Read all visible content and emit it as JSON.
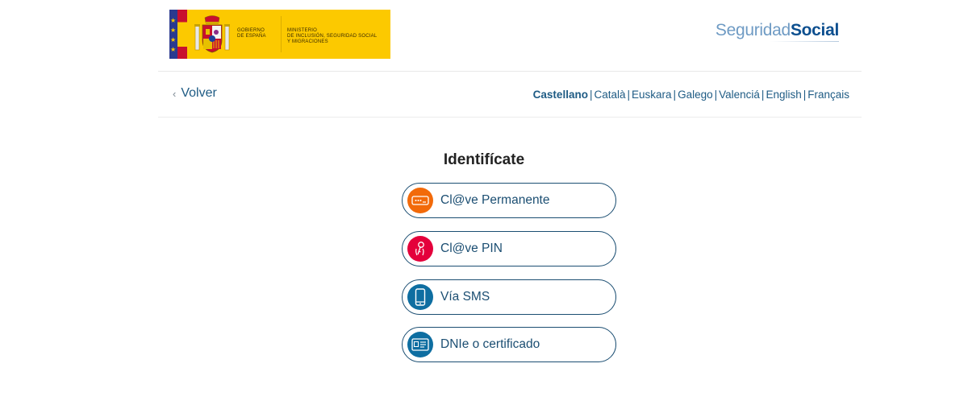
{
  "header": {
    "gov_line1": "GOBIERNO",
    "gov_line2": "DE ESPAÑA",
    "ministry_line1": "MINISTERIO",
    "ministry_line2": "DE INCLUSIÓN, SEGURIDAD SOCIAL",
    "ministry_line3": "Y MIGRACIONES",
    "ss_logo_light": "Seguridad",
    "ss_logo_bold": "Social"
  },
  "nav": {
    "back_label": "Volver",
    "back_chevron": "‹",
    "languages": [
      {
        "label": "Castellano",
        "active": true
      },
      {
        "label": "Català",
        "active": false
      },
      {
        "label": "Euskara",
        "active": false
      },
      {
        "label": "Galego",
        "active": false
      },
      {
        "label": "Valenciá",
        "active": false
      },
      {
        "label": "English",
        "active": false
      },
      {
        "label": "Français",
        "active": false
      }
    ],
    "separator": "|"
  },
  "identify": {
    "title": "Identifícate",
    "options": [
      {
        "label": "Cl@ve Permanente",
        "icon": "password-field-icon",
        "color": "#f26a0a"
      },
      {
        "label": "Cl@ve PIN",
        "icon": "key-hand-icon",
        "color": "#e4003b"
      },
      {
        "label": "Vía SMS",
        "icon": "mobile-phone-icon",
        "color": "#0e6ea1"
      },
      {
        "label": "DNIe o certificado",
        "icon": "id-card-icon",
        "color": "#0e6ea1"
      }
    ]
  },
  "colors": {
    "link": "#1e5b84",
    "border": "#1b4e72",
    "gov_yellow": "#fcc900"
  }
}
